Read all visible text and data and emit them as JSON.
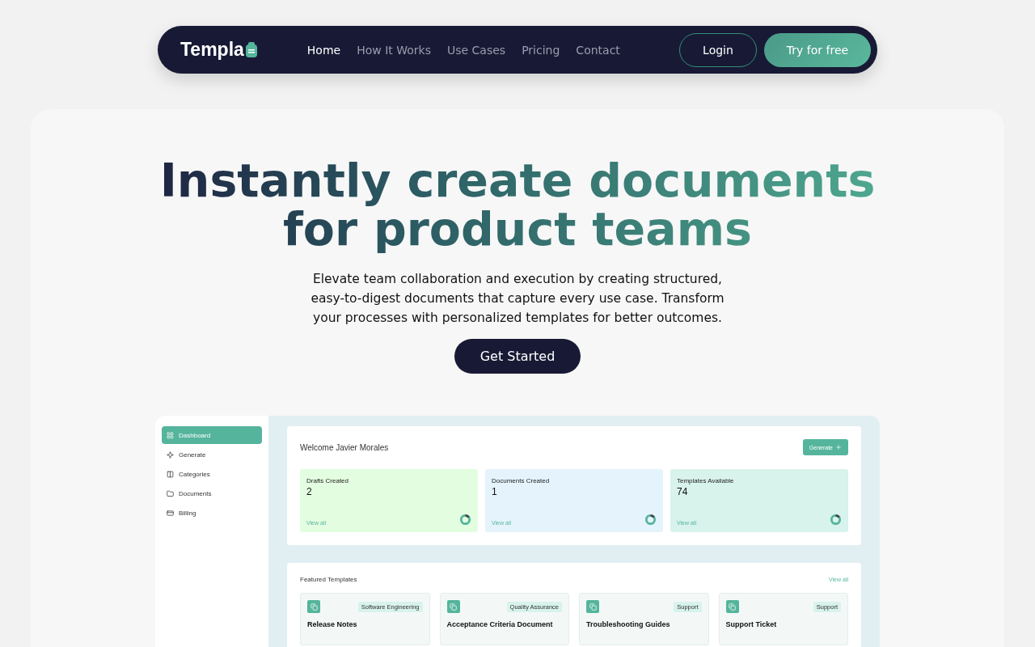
{
  "nav": {
    "logo": "Templa",
    "links": [
      {
        "label": "Home",
        "selected": true
      },
      {
        "label": "How It Works",
        "selected": false
      },
      {
        "label": "Use Cases",
        "selected": false
      },
      {
        "label": "Pricing",
        "selected": false
      },
      {
        "label": "Contact",
        "selected": false
      }
    ],
    "login": "Login",
    "cta": "Try for free"
  },
  "hero": {
    "title": "Instantly create documents for product teams",
    "subtitle": "Elevate team collaboration and execution by creating structured, easy-to-digest documents that capture every use case. Transform your processes with personalized templates for better outcomes.",
    "button": "Get Started"
  },
  "dashboard": {
    "sidebar": [
      {
        "label": "Dashboard",
        "selected": true
      },
      {
        "label": "Generate",
        "selected": false
      },
      {
        "label": "Categories",
        "selected": false
      },
      {
        "label": "Documents",
        "selected": false
      },
      {
        "label": "Billing",
        "selected": false
      }
    ],
    "welcome": "Welcome Javier Morales",
    "generate": "Generate",
    "stats": [
      {
        "label": "Drafts Created",
        "value": "2",
        "link": "View all",
        "color": "#e3fde0"
      },
      {
        "label": "Documents Created",
        "value": "1",
        "link": "View all",
        "color": "#e4f3fc"
      },
      {
        "label": "Templates Available",
        "value": "74",
        "link": "View all",
        "color": "#d8f2ec"
      }
    ],
    "featured_title": "Featured Templates",
    "featured_link": "View all",
    "templates": [
      {
        "tag": "Software Engineering",
        "title": "Release Notes"
      },
      {
        "tag": "Quality Assurance",
        "title": "Acceptance Criteria Document"
      },
      {
        "tag": "Support",
        "title": "Troubleshooting Guides"
      },
      {
        "tag": "Support",
        "title": "Support Ticket"
      }
    ]
  }
}
